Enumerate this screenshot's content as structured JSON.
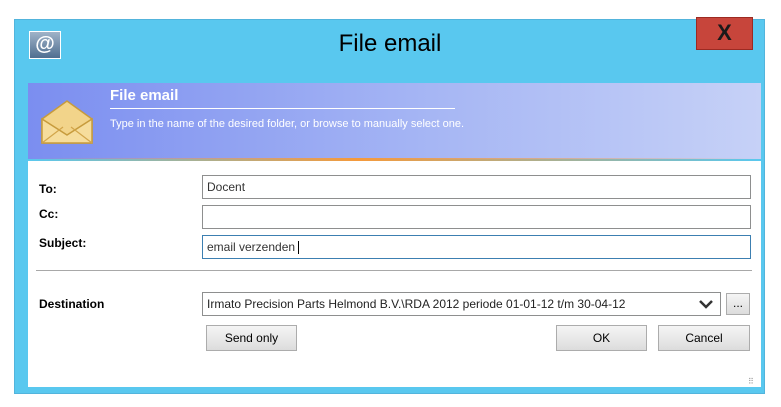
{
  "window": {
    "title": "File email",
    "app_icon": "@",
    "close_label": "X"
  },
  "banner": {
    "title": "File email",
    "subtitle": "Type in the name of the desired folder, or browse to manually select one."
  },
  "form": {
    "to": {
      "label": "To:",
      "value": "Docent"
    },
    "cc": {
      "label": "Cc:",
      "value": ""
    },
    "subject": {
      "label": "Subject:",
      "value": "email verzenden"
    },
    "destination": {
      "label": "Destination",
      "value": "Irmato Precision Parts Helmond B.V.\\RDA 2012 periode 01-01-12 t/m 30-04-12",
      "browse_label": "..."
    }
  },
  "buttons": {
    "send_only": "Send only",
    "ok": "OK",
    "cancel": "Cancel"
  },
  "icons": {
    "app": "at-sign-icon",
    "header": "envelope-icon",
    "dropdown": "chevron-down-icon",
    "grip": "resize-grip-icon"
  },
  "colors": {
    "titlebar": "#59c8ef",
    "banner": "#8fa2f2",
    "close": "#c7453b",
    "accent": "#f59a3c"
  }
}
